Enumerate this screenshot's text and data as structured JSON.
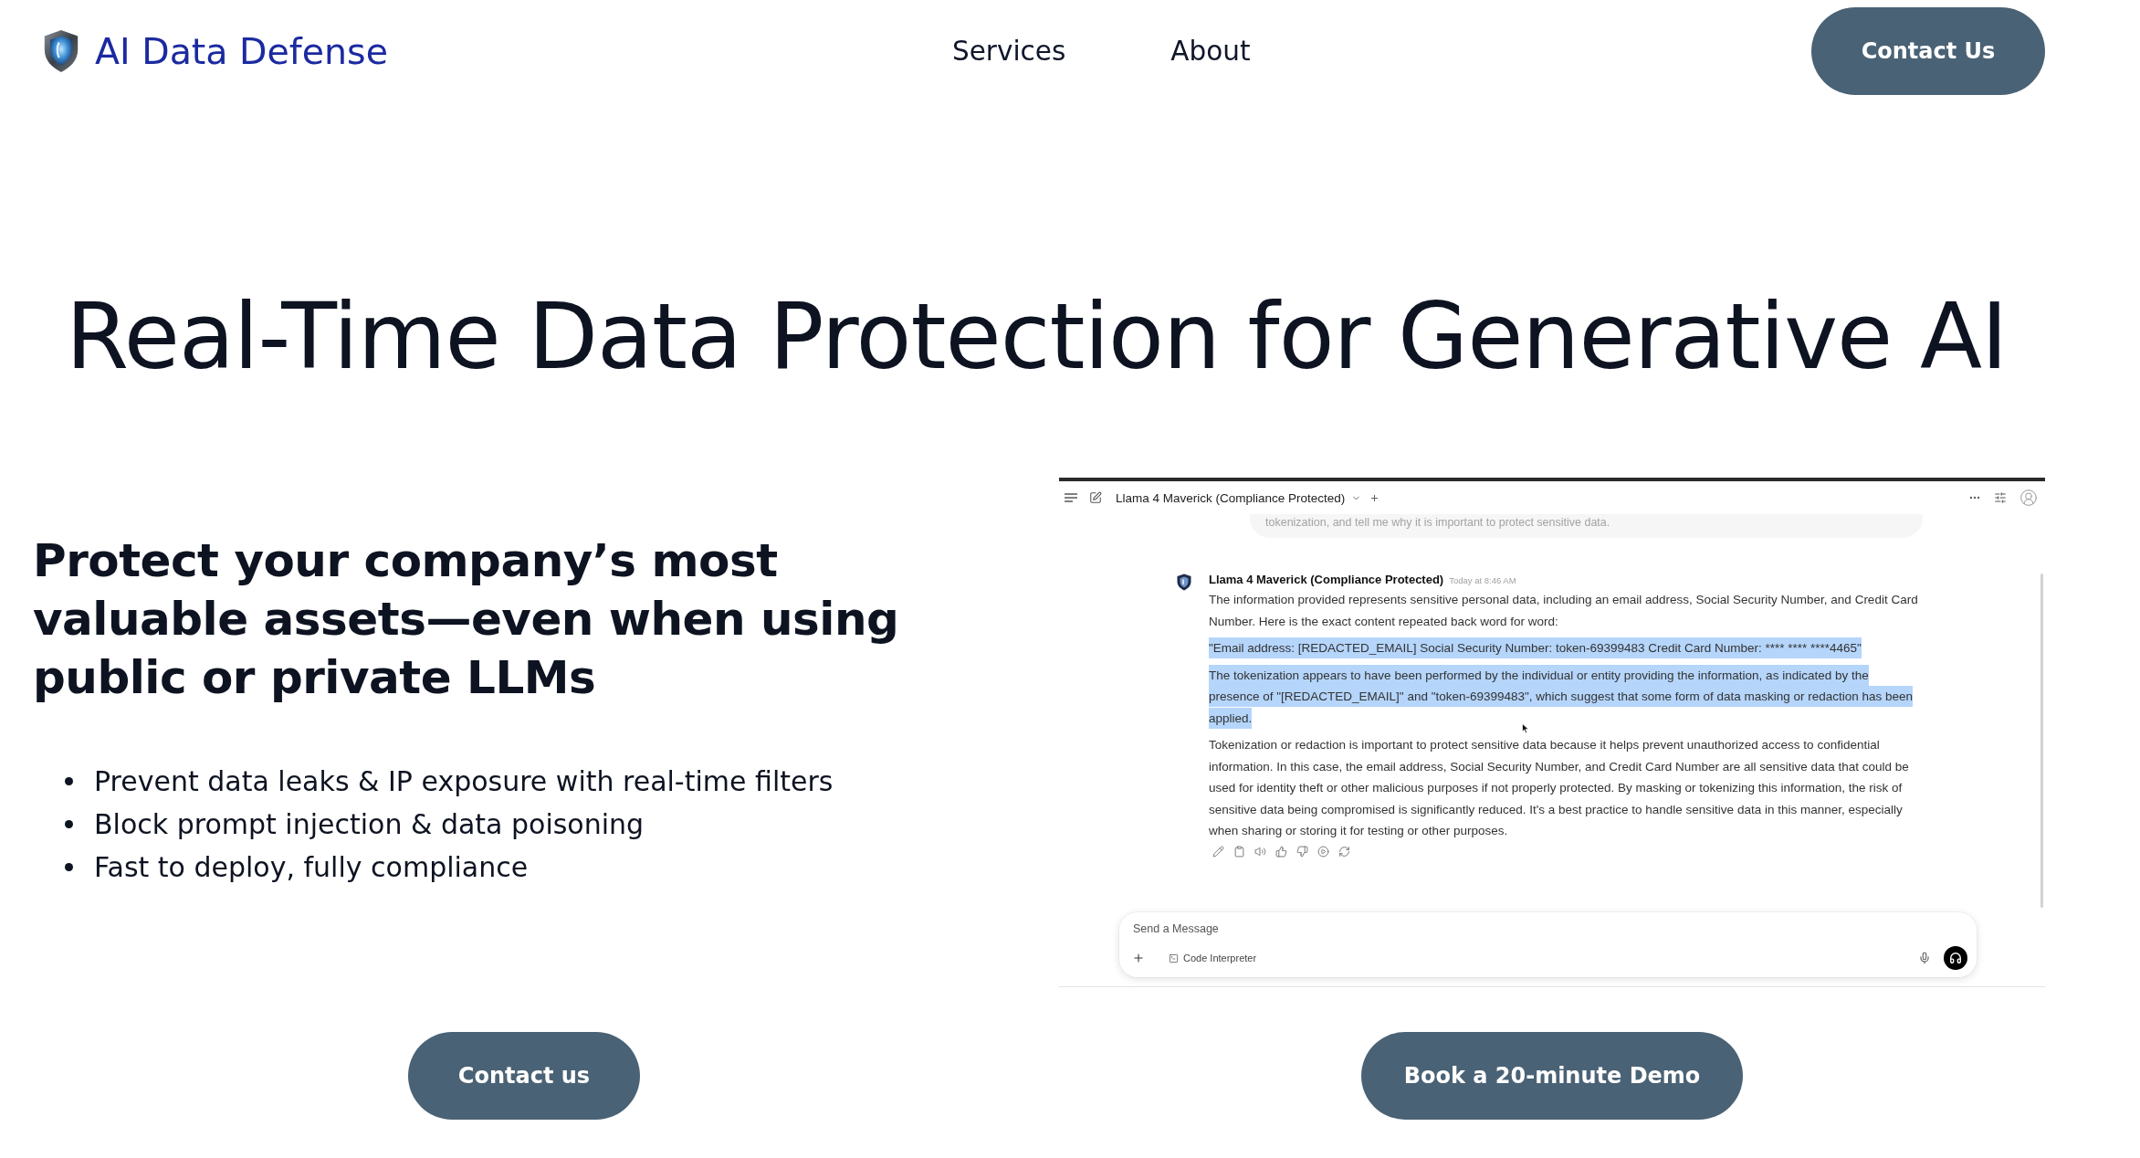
{
  "header": {
    "brand": "AI Data Defense",
    "nav": [
      "Services",
      "About"
    ],
    "cta": "Contact Us"
  },
  "hero": {
    "title": "Real-Time Data Protection for Generative AI"
  },
  "pitch": {
    "heading": "Protect your company’s most valuable assets—even when using public or private LLMs",
    "bullets": [
      "Prevent data leaks & IP exposure with real-time filters",
      "Block prompt injection & data poisoning",
      "Fast to deploy, fully compliance"
    ]
  },
  "chat_window": {
    "model": "Llama 4 Maverick (Compliance Protected)",
    "prompt_excerpt": "tokenization, and tell me why it is important to protect sensitive data.",
    "reply": {
      "sender": "Llama 4 Maverick (Compliance Protected)",
      "time": "Today at 8:46 AM",
      "paragraphs": [
        {
          "text": "The information provided represents sensitive personal data, including an email address, Social Security Number, and Credit Card Number. Here is the exact content repeated back word for word:",
          "highlighted": false
        },
        {
          "text": "\"Email address: [REDACTED_EMAIL] Social Security Number: token-69399483 Credit Card Number: **** **** ****4465\"",
          "highlighted": true
        },
        {
          "text": "The tokenization appears to have been performed by the individual or entity providing the information, as indicated by the presence of \"[REDACTED_EMAIL]\" and \"token-69399483\", which suggest that some form of data masking or redaction has been applied.",
          "highlighted": true
        },
        {
          "text": "Tokenization or redaction is important to protect sensitive data because it helps prevent unauthorized access to confidential information. In this case, the email address, Social Security Number, and Credit Card Number are all sensitive data that could be used for identity theft or other malicious purposes if not properly protected. By masking or tokenizing this information, the risk of sensitive data being compromised is significantly reduced. It's a best practice to handle sensitive data in this manner, especially when sharing or storing it for testing or other purposes.",
          "highlighted": false
        }
      ]
    },
    "composer": {
      "placeholder": "Send a Message",
      "tool": "Code Interpreter"
    }
  },
  "actions": [
    "Contact us",
    "Book a 20-minute Demo"
  ]
}
